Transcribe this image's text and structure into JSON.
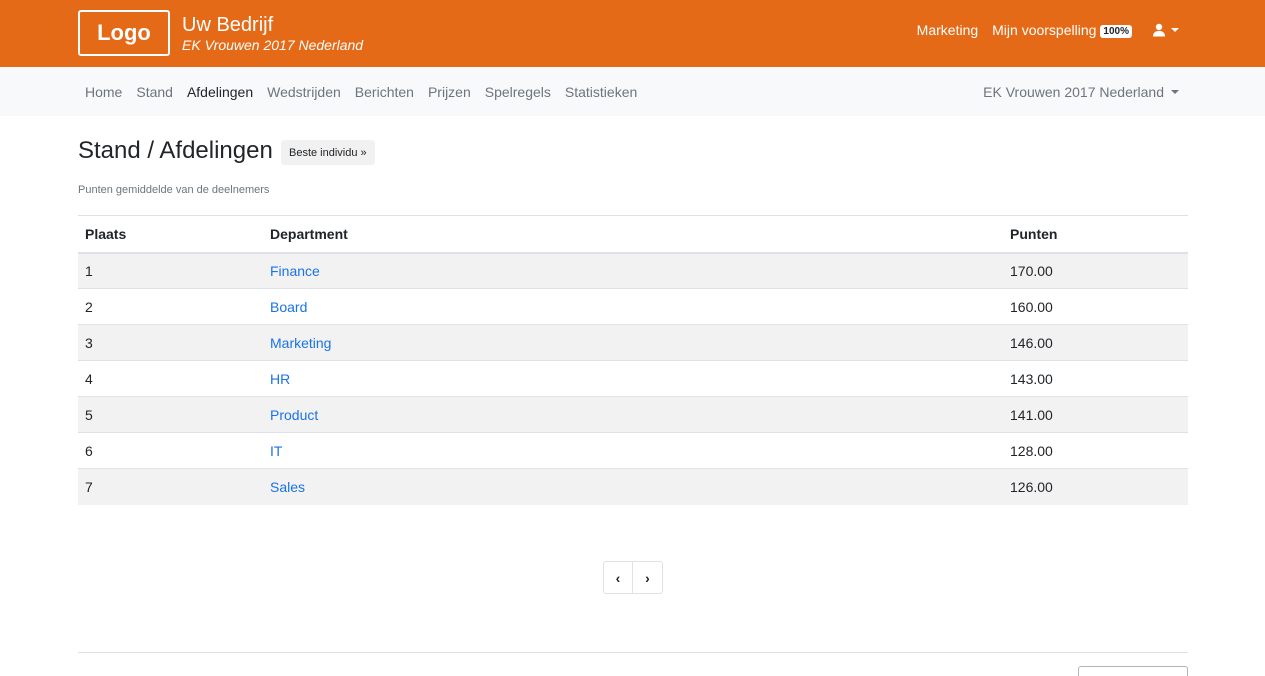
{
  "header": {
    "logo": "Logo",
    "brand_title": "Uw Bedrijf",
    "brand_subtitle": "EK Vrouwen 2017 Nederland",
    "marketing_link": "Marketing",
    "prediction_link": "Mijn voorspelling",
    "prediction_badge": "100%",
    "user_icon": "user-icon"
  },
  "nav": {
    "items": [
      {
        "label": "Home"
      },
      {
        "label": "Stand"
      },
      {
        "label": "Afdelingen",
        "active": true
      },
      {
        "label": "Wedstrijden"
      },
      {
        "label": "Berichten"
      },
      {
        "label": "Prijzen"
      },
      {
        "label": "Spelregels"
      },
      {
        "label": "Statistieken"
      }
    ],
    "tournament_select": "EK Vrouwen 2017 Nederland"
  },
  "main": {
    "title": "Stand / Afdelingen",
    "individual_button": "Beste individu »",
    "note": "Punten gemiddelde van de deelnemers",
    "table": {
      "headers": [
        "Plaats",
        "Department",
        "Punten"
      ],
      "rows": [
        {
          "place": "1",
          "department": "Finance",
          "points": "170.00"
        },
        {
          "place": "2",
          "department": "Board",
          "points": "160.00"
        },
        {
          "place": "3",
          "department": "Marketing",
          "points": "146.00"
        },
        {
          "place": "4",
          "department": "HR",
          "points": "143.00"
        },
        {
          "place": "5",
          "department": "Product",
          "points": "141.00"
        },
        {
          "place": "6",
          "department": "IT",
          "points": "128.00"
        },
        {
          "place": "7",
          "department": "Sales",
          "points": "126.00"
        }
      ]
    },
    "pagination": {
      "prev": "‹",
      "next": "›"
    }
  },
  "colors": {
    "brand": "#e56a17",
    "link": "#1a73e8"
  }
}
